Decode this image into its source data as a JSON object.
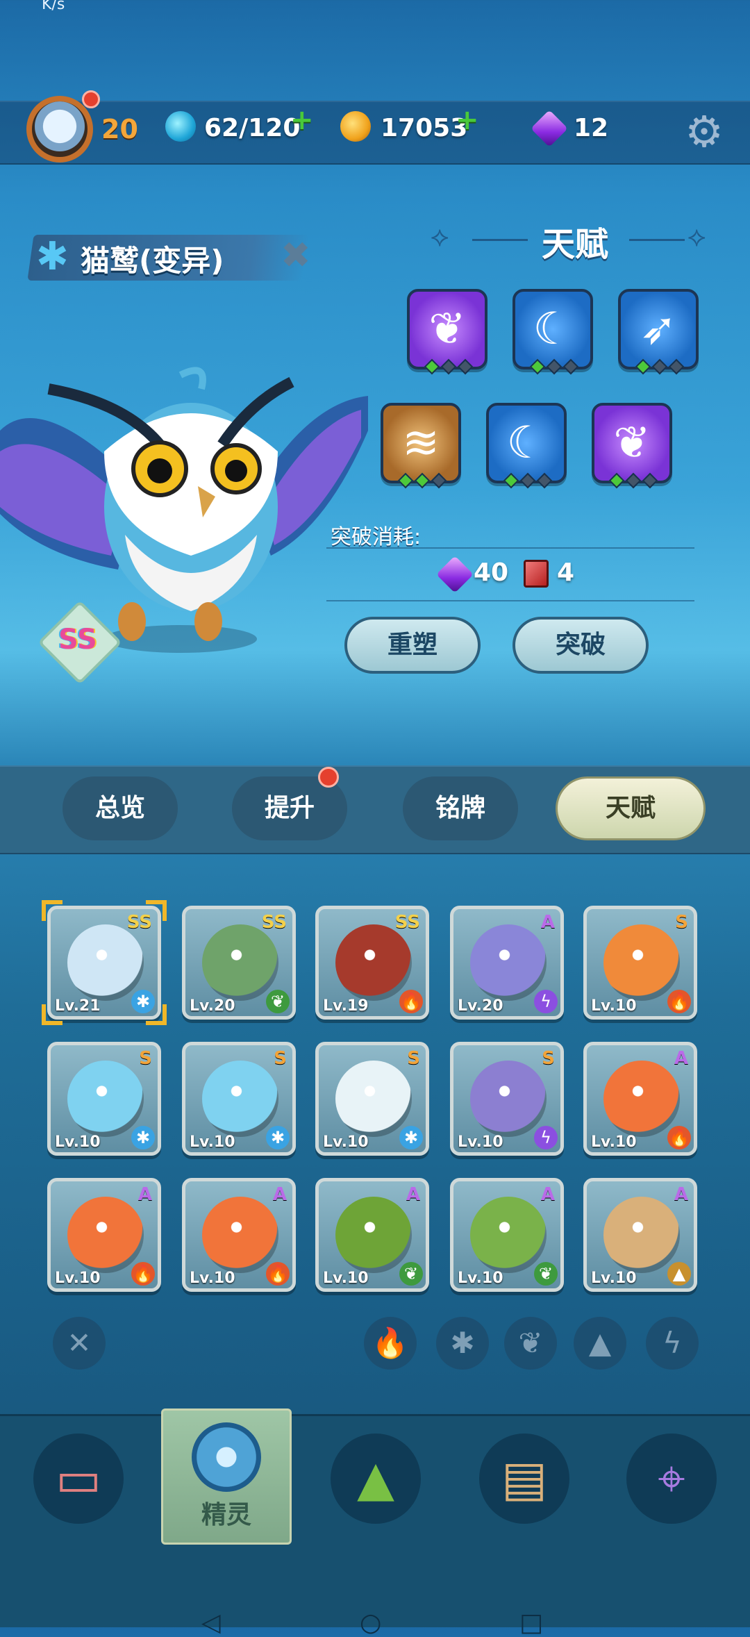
{
  "status_bar": {
    "left_text": "K/s"
  },
  "player": {
    "level": "20"
  },
  "resources": [
    {
      "name": "water-drop",
      "value": "62/120",
      "addable": true
    },
    {
      "name": "paw-coin",
      "value": "17053",
      "addable": true
    },
    {
      "name": "purple-gem",
      "value": "12",
      "addable": false
    }
  ],
  "pet": {
    "name": "猫鹫(变异)",
    "rank": "SS"
  },
  "talent": {
    "title": "天赋",
    "slots": [
      {
        "icon": "feather-icon",
        "color": "purple",
        "pips": [
          1,
          0,
          0
        ]
      },
      {
        "icon": "moon-icon",
        "color": "blue",
        "pips": [
          1,
          0,
          0
        ]
      },
      {
        "icon": "bird-icon",
        "color": "blue",
        "pips": [
          1,
          0,
          0
        ]
      },
      {
        "icon": "wave-icon",
        "color": "gold",
        "pips": [
          1,
          1,
          0
        ]
      },
      {
        "icon": "moon-icon",
        "color": "blue",
        "pips": [
          1,
          0,
          0
        ]
      },
      {
        "icon": "feather-icon",
        "color": "purple",
        "pips": [
          1,
          0,
          0
        ]
      }
    ],
    "cost_label": "突破消耗:",
    "cost_gem": "40",
    "cost_book": "4",
    "reshape": "重塑",
    "breakthrough": "突破"
  },
  "tabs": [
    "总览",
    "提升",
    "铭牌",
    "天赋"
  ],
  "active_tab": "天赋",
  "creatures": [
    {
      "lv": "Lv.21",
      "rank": "SS",
      "element": "ice",
      "color": "#cfe6f5"
    },
    {
      "lv": "Lv.20",
      "rank": "SS",
      "element": "leaf",
      "color": "#6fa36a"
    },
    {
      "lv": "Lv.19",
      "rank": "SS",
      "element": "fire",
      "color": "#a63a2c"
    },
    {
      "lv": "Lv.20",
      "rank": "A",
      "element": "thunder",
      "color": "#8a86d8"
    },
    {
      "lv": "Lv.10",
      "rank": "S",
      "element": "fire",
      "color": "#f08a3a"
    },
    {
      "lv": "Lv.10",
      "rank": "S",
      "element": "ice",
      "color": "#7fd2f0"
    },
    {
      "lv": "Lv.10",
      "rank": "S",
      "element": "ice",
      "color": "#7fd2f0"
    },
    {
      "lv": "Lv.10",
      "rank": "S",
      "element": "ice",
      "color": "#e8f3f7"
    },
    {
      "lv": "Lv.10",
      "rank": "S",
      "element": "thunder",
      "color": "#8c7fd1"
    },
    {
      "lv": "Lv.10",
      "rank": "A",
      "element": "fire",
      "color": "#f1743a"
    },
    {
      "lv": "Lv.10",
      "rank": "A",
      "element": "fire",
      "color": "#f1743a"
    },
    {
      "lv": "Lv.10",
      "rank": "A",
      "element": "fire",
      "color": "#f1743a"
    },
    {
      "lv": "Lv.10",
      "rank": "A",
      "element": "leaf",
      "color": "#6ea437"
    },
    {
      "lv": "Lv.10",
      "rank": "A",
      "element": "leaf",
      "color": "#7ab24a"
    },
    {
      "lv": "Lv.10",
      "rank": "A",
      "element": "earth",
      "color": "#d9b07a"
    }
  ],
  "filters": [
    "clear-filter-icon",
    "fire-filter-icon",
    "ice-filter-icon",
    "leaf-filter-icon",
    "earth-filter-icon",
    "thunder-filter-icon"
  ],
  "bottom_nav": {
    "active_label": "精灵"
  },
  "colors": {
    "fire": "#e3562a",
    "ice": "#3aa3e3",
    "leaf": "#3e9a3e",
    "thunder": "#8b4fe0",
    "earth": "#c8902e",
    "rank_SS": "#f3d04a",
    "rank_S": "#f2a43a",
    "rank_A": "#b96be8"
  }
}
